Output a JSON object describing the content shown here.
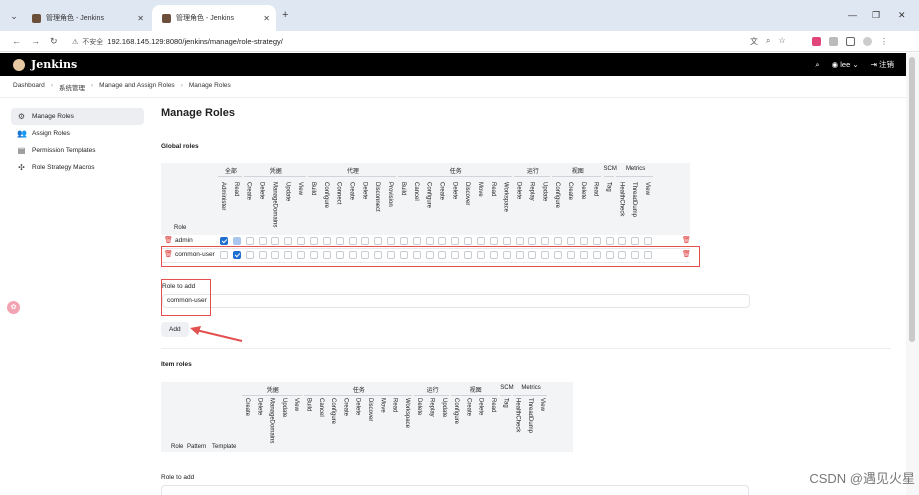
{
  "browser": {
    "tabs": [
      {
        "title": "管理角色 - Jenkins",
        "active": false
      },
      {
        "title": "管理角色 - Jenkins",
        "active": true
      }
    ],
    "insecure_label": "不安全",
    "url": "192.168.145.129:8080/jenkins/manage/role-strategy/"
  },
  "header": {
    "title": "Jenkins",
    "user": "lee",
    "logout": "注销"
  },
  "breadcrumb": [
    "Dashboard",
    "系统管理",
    "Manage and Assign Roles",
    "Manage Roles"
  ],
  "sidebar": {
    "items": [
      {
        "label": "Manage Roles",
        "active": true
      },
      {
        "label": "Assign Roles",
        "active": false
      },
      {
        "label": "Permission Templates",
        "active": false
      },
      {
        "label": "Role Strategy Macros",
        "active": false
      }
    ]
  },
  "page_title": "Manage Roles",
  "global_roles": {
    "section_title": "Global roles",
    "role_header": "Role",
    "groups": [
      {
        "name": "全部",
        "perms": [
          "Administer",
          "Read"
        ]
      },
      {
        "name": "凭据",
        "perms": [
          "Create",
          "Delete",
          "ManageDomains",
          "Update",
          "View"
        ]
      },
      {
        "name": "代理",
        "perms": [
          "Build",
          "Configure",
          "Connect",
          "Create",
          "Delete",
          "Disconnect",
          "Provision"
        ]
      },
      {
        "name": "任务",
        "perms": [
          "Build",
          "Cancel",
          "Configure",
          "Create",
          "Delete",
          "Discover",
          "Move",
          "Read",
          "Workspace"
        ]
      },
      {
        "name": "运行",
        "perms": [
          "Delete",
          "Replay",
          "Update"
        ]
      },
      {
        "name": "视图",
        "perms": [
          "Configure",
          "Create",
          "Delete",
          "Read"
        ]
      },
      {
        "name": "SCM",
        "perms": [
          "Tag"
        ]
      },
      {
        "name": "Metrics",
        "perms": [
          "HealthCheck",
          "ThreadDump",
          "View"
        ]
      }
    ],
    "rows": [
      {
        "name": "admin",
        "checked": [
          0
        ],
        "dim": [
          1
        ]
      },
      {
        "name": "common-user",
        "checked": [
          1
        ],
        "dim": []
      }
    ]
  },
  "add_global": {
    "label": "Role to add",
    "value": "common-user",
    "button": "Add"
  },
  "item_roles": {
    "section_title": "Item roles",
    "fixed_headers": [
      "Role",
      "Pattern",
      "Template"
    ],
    "groups": [
      {
        "name": "凭据",
        "perms": [
          "Create",
          "Delete",
          "ManageDomains",
          "Update",
          "View"
        ]
      },
      {
        "name": "任务",
        "perms": [
          "Build",
          "Cancel",
          "Configure",
          "Create",
          "Delete",
          "Discover",
          "Move",
          "Read",
          "Workspace"
        ]
      },
      {
        "name": "运行",
        "perms": [
          "Delete",
          "Replay",
          "Update"
        ]
      },
      {
        "name": "视图",
        "perms": [
          "Configure",
          "Create",
          "Delete",
          "Read"
        ]
      },
      {
        "name": "SCM",
        "perms": [
          "Tag"
        ]
      },
      {
        "name": "Metrics",
        "perms": [
          "HealthCheck",
          "ThreadDump",
          "View"
        ]
      }
    ]
  },
  "add_item": {
    "label": "Role to add"
  },
  "watermark": "CSDN @遇见火星",
  "colors": {
    "accent": "#1f6fd1",
    "highlight": "#e35050",
    "header_bg": "#000000"
  }
}
